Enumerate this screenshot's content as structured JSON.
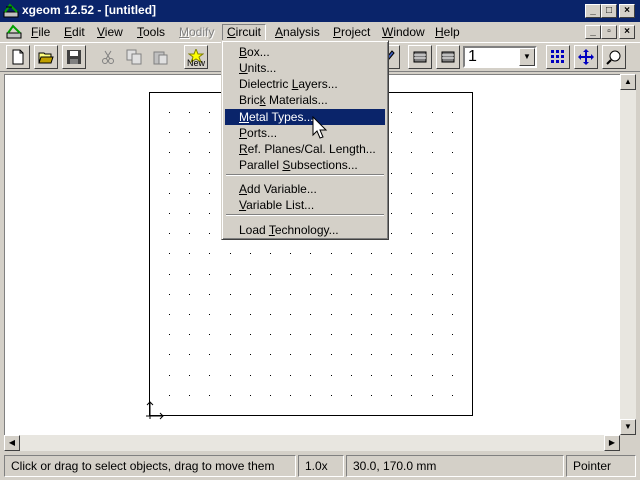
{
  "window": {
    "title": "xgeom 12.52 - [untitled]",
    "controls": {
      "minimize": "_",
      "maximize": "□",
      "close": "×"
    }
  },
  "menubar": {
    "items": [
      {
        "label": "File",
        "accel": "F"
      },
      {
        "label": "Edit",
        "accel": "E"
      },
      {
        "label": "View",
        "accel": "V"
      },
      {
        "label": "Tools",
        "accel": "T"
      },
      {
        "label": "Modify",
        "accel": "M",
        "disabled": true
      },
      {
        "label": "Circuit",
        "accel": "C",
        "active": true
      },
      {
        "label": "Analysis",
        "accel": "A"
      },
      {
        "label": "Project",
        "accel": "P"
      },
      {
        "label": "Window",
        "accel": "W"
      },
      {
        "label": "Help",
        "accel": "H"
      }
    ],
    "doc_controls": {
      "minimize": "_",
      "restore": "▫",
      "close": "×"
    }
  },
  "toolbar": {
    "new_label": "New",
    "level_combo": "1"
  },
  "circuit_menu": {
    "items": [
      {
        "label": "Box...",
        "accel_index": 0
      },
      {
        "label": "Units...",
        "accel_index": 0
      },
      {
        "label": "Dielectric Layers...",
        "accel_index": 11
      },
      {
        "label": "Brick Materials...",
        "accel_index": 4
      },
      {
        "label": "Metal Types...",
        "accel_index": 0,
        "highlighted": true
      },
      {
        "label": "Ports...",
        "accel_index": 0
      },
      {
        "label": "Ref. Planes/Cal. Length...",
        "accel_index": 0
      },
      {
        "label": "Parallel Subsections...",
        "accel_index": 9
      },
      {
        "label": "Add Variable...",
        "accel_index": 0
      },
      {
        "label": "Variable List...",
        "accel_index": 0
      },
      {
        "label": "Load Technology...",
        "accel_index": 5
      }
    ]
  },
  "statusbar": {
    "hint": "Click or drag to select objects, drag to move them",
    "zoom": "1.0x",
    "coords": "30.0, 170.0 mm",
    "mode": "Pointer"
  },
  "colors": {
    "titlebar": "#0a246a",
    "face": "#d4d0c8",
    "highlight": "#0a246a"
  }
}
